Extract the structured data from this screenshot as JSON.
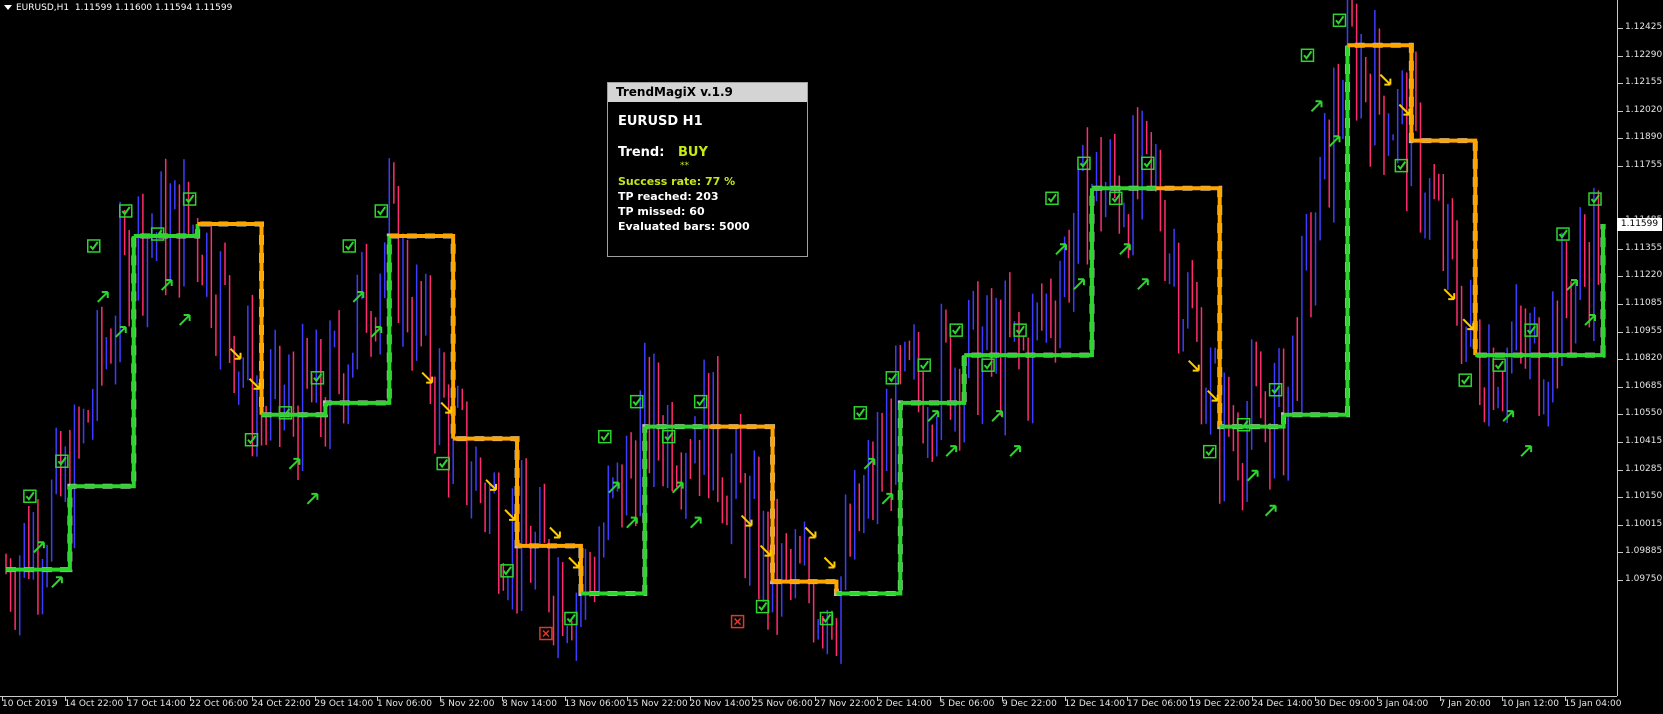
{
  "header": {
    "symbol_timeframe": "EURUSD,H1",
    "ohlc": "1.11599 1.11600 1.11594 1.11599"
  },
  "price_axis": {
    "labels": [
      "1.12425",
      "1.12290",
      "1.12155",
      "1.12020",
      "1.11890",
      "1.11755",
      "1.11485",
      "1.11355",
      "1.11220",
      "1.11085",
      "1.10955",
      "1.10820",
      "1.10685",
      "1.10550",
      "1.10415",
      "1.10285",
      "1.10150",
      "1.10015",
      "1.09885",
      "1.09750"
    ],
    "current_price": "1.11599"
  },
  "time_axis": {
    "labels": [
      "10 Oct 2019",
      "14 Oct 22:00",
      "17 Oct 14:00",
      "22 Oct 06:00",
      "24 Oct 22:00",
      "29 Oct 14:00",
      "1 Nov 06:00",
      "5 Nov 22:00",
      "8 Nov 14:00",
      "13 Nov 06:00",
      "15 Nov 22:00",
      "20 Nov 14:00",
      "25 Nov 06:00",
      "27 Nov 22:00",
      "2 Dec 14:00",
      "5 Dec 06:00",
      "9 Dec 22:00",
      "12 Dec 14:00",
      "17 Dec 06:00",
      "19 Dec 22:00",
      "24 Dec 14:00",
      "30 Dec 09:00",
      "3 Jan 04:00",
      "7 Jan 20:00",
      "10 Jan 12:00",
      "15 Jan 04:00"
    ]
  },
  "indicator_panel": {
    "title": "TrendMagiX v.1.9",
    "symbol": "EURUSD  H1",
    "trend_label": "Trend:",
    "trend_value": "BUY",
    "trend_stars": "**",
    "success_rate": "Success rate: 77 %",
    "tp_reached": "TP reached: 203",
    "tp_missed": "TP missed:  60",
    "evaluated_bars": "Evaluated bars: 5000"
  },
  "colors": {
    "background": "#000000",
    "buy_line": "#2fd52f",
    "sell_line": "#ffa500",
    "neutral_line": "#bfbfbf",
    "candle_up": "#3d3dff",
    "candle_down": "#ff2d6f",
    "buy_signal": "#2fd52f",
    "sell_signal": "#ffcc00",
    "tp_missed": "#d93a2b"
  },
  "chart_data": {
    "type": "line",
    "instrument": "EURUSD",
    "timeframe": "H1",
    "y_range": [
      1.0962,
      1.1254
    ],
    "x": [
      "10 Oct 2019",
      "14 Oct 22:00",
      "17 Oct 14:00",
      "22 Oct 06:00",
      "24 Oct 22:00",
      "29 Oct 14:00",
      "1 Nov 06:00",
      "5 Nov 22:00",
      "8 Nov 14:00",
      "13 Nov 06:00",
      "15 Nov 22:00",
      "20 Nov 14:00",
      "25 Nov 06:00",
      "27 Nov 22:00",
      "2 Dec 14:00",
      "5 Dec 06:00",
      "9 Dec 22:00",
      "12 Dec 14:00",
      "17 Dec 06:00",
      "19 Dec 22:00",
      "24 Dec 14:00",
      "30 Dec 09:00",
      "3 Jan 04:00",
      "7 Jan 20:00",
      "10 Jan 12:00",
      "15 Jan 04:00"
    ],
    "series": [
      {
        "values": [
          1.1015,
          1.105,
          1.1155,
          1.116,
          1.108,
          1.1085,
          1.1155,
          1.107,
          1.1025,
          1.1005,
          1.1075,
          1.1075,
          1.101,
          1.1005,
          1.1085,
          1.1105,
          1.1105,
          1.1175,
          1.1175,
          1.1075,
          1.108,
          1.1235,
          1.1195,
          1.1105,
          1.1105,
          1.116
        ]
      }
    ]
  }
}
